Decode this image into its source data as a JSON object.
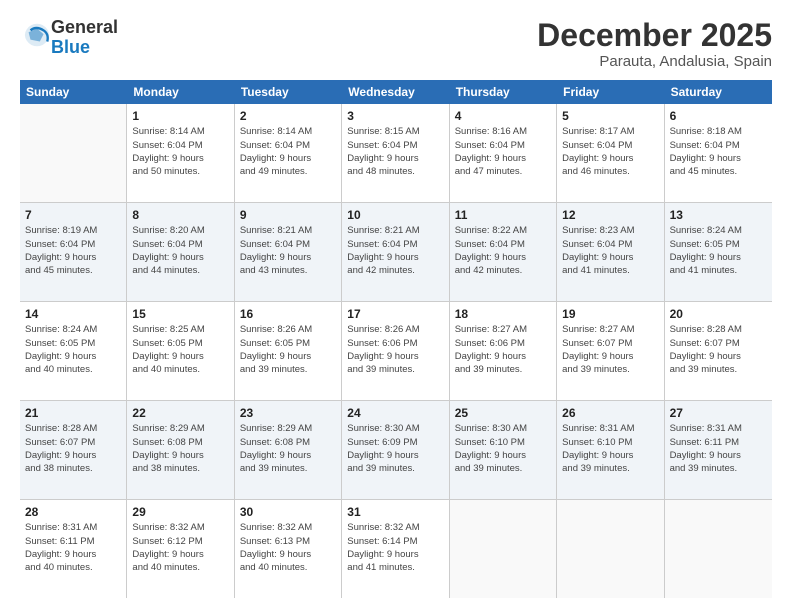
{
  "logo": {
    "general": "General",
    "blue": "Blue"
  },
  "title": "December 2025",
  "subtitle": "Parauta, Andalusia, Spain",
  "header": {
    "days": [
      "Sunday",
      "Monday",
      "Tuesday",
      "Wednesday",
      "Thursday",
      "Friday",
      "Saturday"
    ]
  },
  "weeks": [
    [
      {
        "day": "",
        "info": ""
      },
      {
        "day": "1",
        "info": "Sunrise: 8:14 AM\nSunset: 6:04 PM\nDaylight: 9 hours\nand 50 minutes."
      },
      {
        "day": "2",
        "info": "Sunrise: 8:14 AM\nSunset: 6:04 PM\nDaylight: 9 hours\nand 49 minutes."
      },
      {
        "day": "3",
        "info": "Sunrise: 8:15 AM\nSunset: 6:04 PM\nDaylight: 9 hours\nand 48 minutes."
      },
      {
        "day": "4",
        "info": "Sunrise: 8:16 AM\nSunset: 6:04 PM\nDaylight: 9 hours\nand 47 minutes."
      },
      {
        "day": "5",
        "info": "Sunrise: 8:17 AM\nSunset: 6:04 PM\nDaylight: 9 hours\nand 46 minutes."
      },
      {
        "day": "6",
        "info": "Sunrise: 8:18 AM\nSunset: 6:04 PM\nDaylight: 9 hours\nand 45 minutes."
      }
    ],
    [
      {
        "day": "7",
        "info": "Sunrise: 8:19 AM\nSunset: 6:04 PM\nDaylight: 9 hours\nand 45 minutes."
      },
      {
        "day": "8",
        "info": "Sunrise: 8:20 AM\nSunset: 6:04 PM\nDaylight: 9 hours\nand 44 minutes."
      },
      {
        "day": "9",
        "info": "Sunrise: 8:21 AM\nSunset: 6:04 PM\nDaylight: 9 hours\nand 43 minutes."
      },
      {
        "day": "10",
        "info": "Sunrise: 8:21 AM\nSunset: 6:04 PM\nDaylight: 9 hours\nand 42 minutes."
      },
      {
        "day": "11",
        "info": "Sunrise: 8:22 AM\nSunset: 6:04 PM\nDaylight: 9 hours\nand 42 minutes."
      },
      {
        "day": "12",
        "info": "Sunrise: 8:23 AM\nSunset: 6:04 PM\nDaylight: 9 hours\nand 41 minutes."
      },
      {
        "day": "13",
        "info": "Sunrise: 8:24 AM\nSunset: 6:05 PM\nDaylight: 9 hours\nand 41 minutes."
      }
    ],
    [
      {
        "day": "14",
        "info": "Sunrise: 8:24 AM\nSunset: 6:05 PM\nDaylight: 9 hours\nand 40 minutes."
      },
      {
        "day": "15",
        "info": "Sunrise: 8:25 AM\nSunset: 6:05 PM\nDaylight: 9 hours\nand 40 minutes."
      },
      {
        "day": "16",
        "info": "Sunrise: 8:26 AM\nSunset: 6:05 PM\nDaylight: 9 hours\nand 39 minutes."
      },
      {
        "day": "17",
        "info": "Sunrise: 8:26 AM\nSunset: 6:06 PM\nDaylight: 9 hours\nand 39 minutes."
      },
      {
        "day": "18",
        "info": "Sunrise: 8:27 AM\nSunset: 6:06 PM\nDaylight: 9 hours\nand 39 minutes."
      },
      {
        "day": "19",
        "info": "Sunrise: 8:27 AM\nSunset: 6:07 PM\nDaylight: 9 hours\nand 39 minutes."
      },
      {
        "day": "20",
        "info": "Sunrise: 8:28 AM\nSunset: 6:07 PM\nDaylight: 9 hours\nand 39 minutes."
      }
    ],
    [
      {
        "day": "21",
        "info": "Sunrise: 8:28 AM\nSunset: 6:07 PM\nDaylight: 9 hours\nand 38 minutes."
      },
      {
        "day": "22",
        "info": "Sunrise: 8:29 AM\nSunset: 6:08 PM\nDaylight: 9 hours\nand 38 minutes."
      },
      {
        "day": "23",
        "info": "Sunrise: 8:29 AM\nSunset: 6:08 PM\nDaylight: 9 hours\nand 39 minutes."
      },
      {
        "day": "24",
        "info": "Sunrise: 8:30 AM\nSunset: 6:09 PM\nDaylight: 9 hours\nand 39 minutes."
      },
      {
        "day": "25",
        "info": "Sunrise: 8:30 AM\nSunset: 6:10 PM\nDaylight: 9 hours\nand 39 minutes."
      },
      {
        "day": "26",
        "info": "Sunrise: 8:31 AM\nSunset: 6:10 PM\nDaylight: 9 hours\nand 39 minutes."
      },
      {
        "day": "27",
        "info": "Sunrise: 8:31 AM\nSunset: 6:11 PM\nDaylight: 9 hours\nand 39 minutes."
      }
    ],
    [
      {
        "day": "28",
        "info": "Sunrise: 8:31 AM\nSunset: 6:11 PM\nDaylight: 9 hours\nand 40 minutes."
      },
      {
        "day": "29",
        "info": "Sunrise: 8:32 AM\nSunset: 6:12 PM\nDaylight: 9 hours\nand 40 minutes."
      },
      {
        "day": "30",
        "info": "Sunrise: 8:32 AM\nSunset: 6:13 PM\nDaylight: 9 hours\nand 40 minutes."
      },
      {
        "day": "31",
        "info": "Sunrise: 8:32 AM\nSunset: 6:14 PM\nDaylight: 9 hours\nand 41 minutes."
      },
      {
        "day": "",
        "info": ""
      },
      {
        "day": "",
        "info": ""
      },
      {
        "day": "",
        "info": ""
      }
    ]
  ]
}
